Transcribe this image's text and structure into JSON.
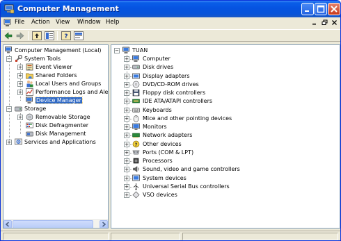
{
  "window": {
    "title": "Computer Management",
    "colors": {
      "titlebar": "#0553e1",
      "selection": "#316ac5",
      "close_button": "#c73b1d"
    }
  },
  "menu": {
    "items": [
      "File",
      "Action",
      "View",
      "Window",
      "Help"
    ]
  },
  "toolbar": {
    "buttons": [
      "back-arrow-icon",
      "forward-arrow-icon",
      "up-folder-icon",
      "show-hide-tree-icon",
      "help-icon",
      "properties-icon"
    ]
  },
  "left_tree": {
    "root": "Computer Management (Local)",
    "system_tools": "System Tools",
    "event_viewer": "Event Viewer",
    "shared_folders": "Shared Folders",
    "local_users": "Local Users and Groups",
    "performance": "Performance Logs and Alerts",
    "device_manager": "Device Manager",
    "storage": "Storage",
    "removable_storage": "Removable Storage",
    "disk_defrag": "Disk Defragmenter",
    "disk_management": "Disk Management",
    "services": "Services and Applications"
  },
  "right_tree": {
    "root": "TUAN",
    "items": [
      "Computer",
      "Disk drives",
      "Display adapters",
      "DVD/CD-ROM drives",
      "Floppy disk controllers",
      "IDE ATA/ATAPI controllers",
      "Keyboards",
      "Mice and other pointing devices",
      "Monitors",
      "Network adapters",
      "Other devices",
      "Ports (COM & LPT)",
      "Processors",
      "Sound, video and game controllers",
      "System devices",
      "Universal Serial Bus controllers",
      "VSO devices"
    ],
    "icons": [
      "computer-icon",
      "disk-drive-icon",
      "display-adapter-icon",
      "dvd-drive-icon",
      "floppy-controller-icon",
      "ide-controller-icon",
      "keyboard-icon",
      "mouse-icon",
      "monitor-icon",
      "network-adapter-icon",
      "other-devices-icon",
      "port-icon",
      "processor-icon",
      "sound-icon",
      "system-devices-icon",
      "usb-icon",
      "vso-device-icon"
    ]
  }
}
